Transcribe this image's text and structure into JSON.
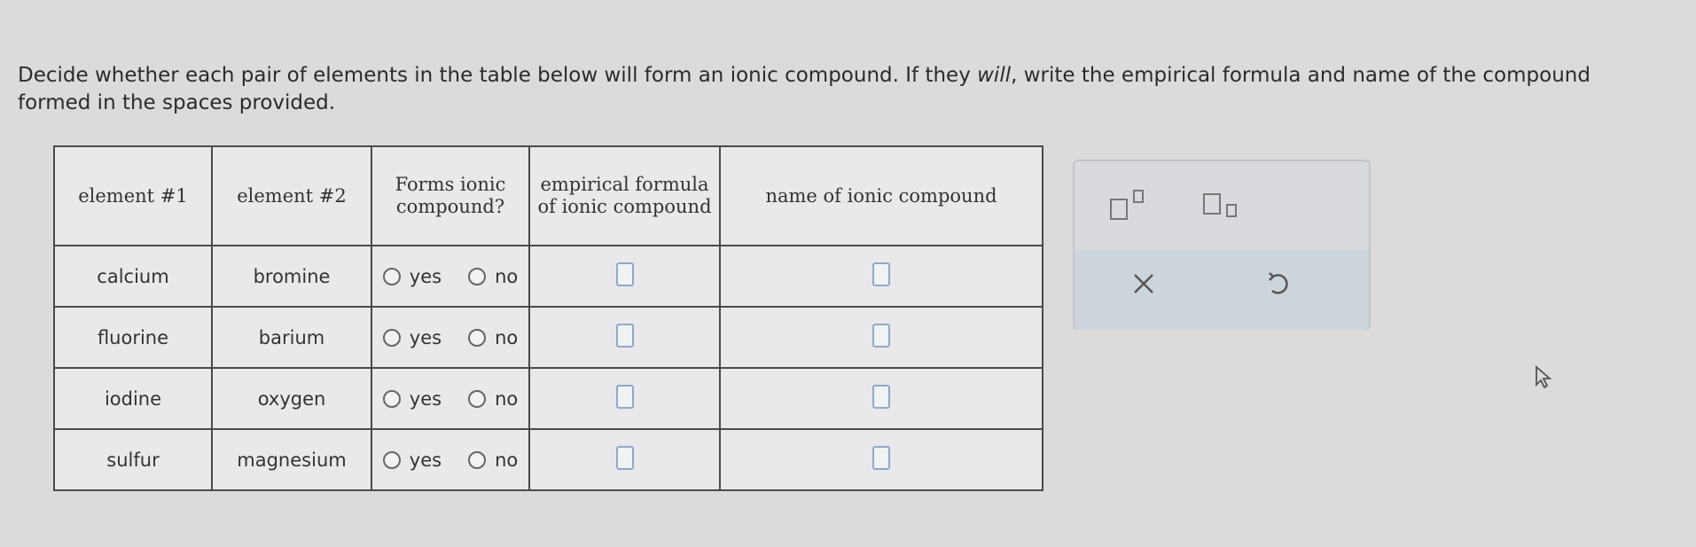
{
  "instructions": {
    "part1": "Decide whether each pair of elements in the table below will form an ionic compound. If they ",
    "emphasis": "will",
    "part2": ", write the empirical formula and name of the compound formed in the spaces provided."
  },
  "table": {
    "headers": {
      "col1": "element #1",
      "col2": "element #2",
      "col3": "Forms ionic compound?",
      "col4": "empirical formula of ionic compound",
      "col5": "name of ionic compound"
    },
    "rows": [
      {
        "element1": "calcium",
        "element2": "bromine"
      },
      {
        "element1": "fluorine",
        "element2": "barium"
      },
      {
        "element1": "iodine",
        "element2": "oxygen"
      },
      {
        "element1": "sulfur",
        "element2": "magnesium"
      }
    ],
    "option_yes": "yes",
    "option_no": "no"
  },
  "tools": {
    "superscript": "superscript-icon",
    "subscript": "subscript-icon",
    "clear": "x-icon",
    "undo": "undo-icon"
  }
}
